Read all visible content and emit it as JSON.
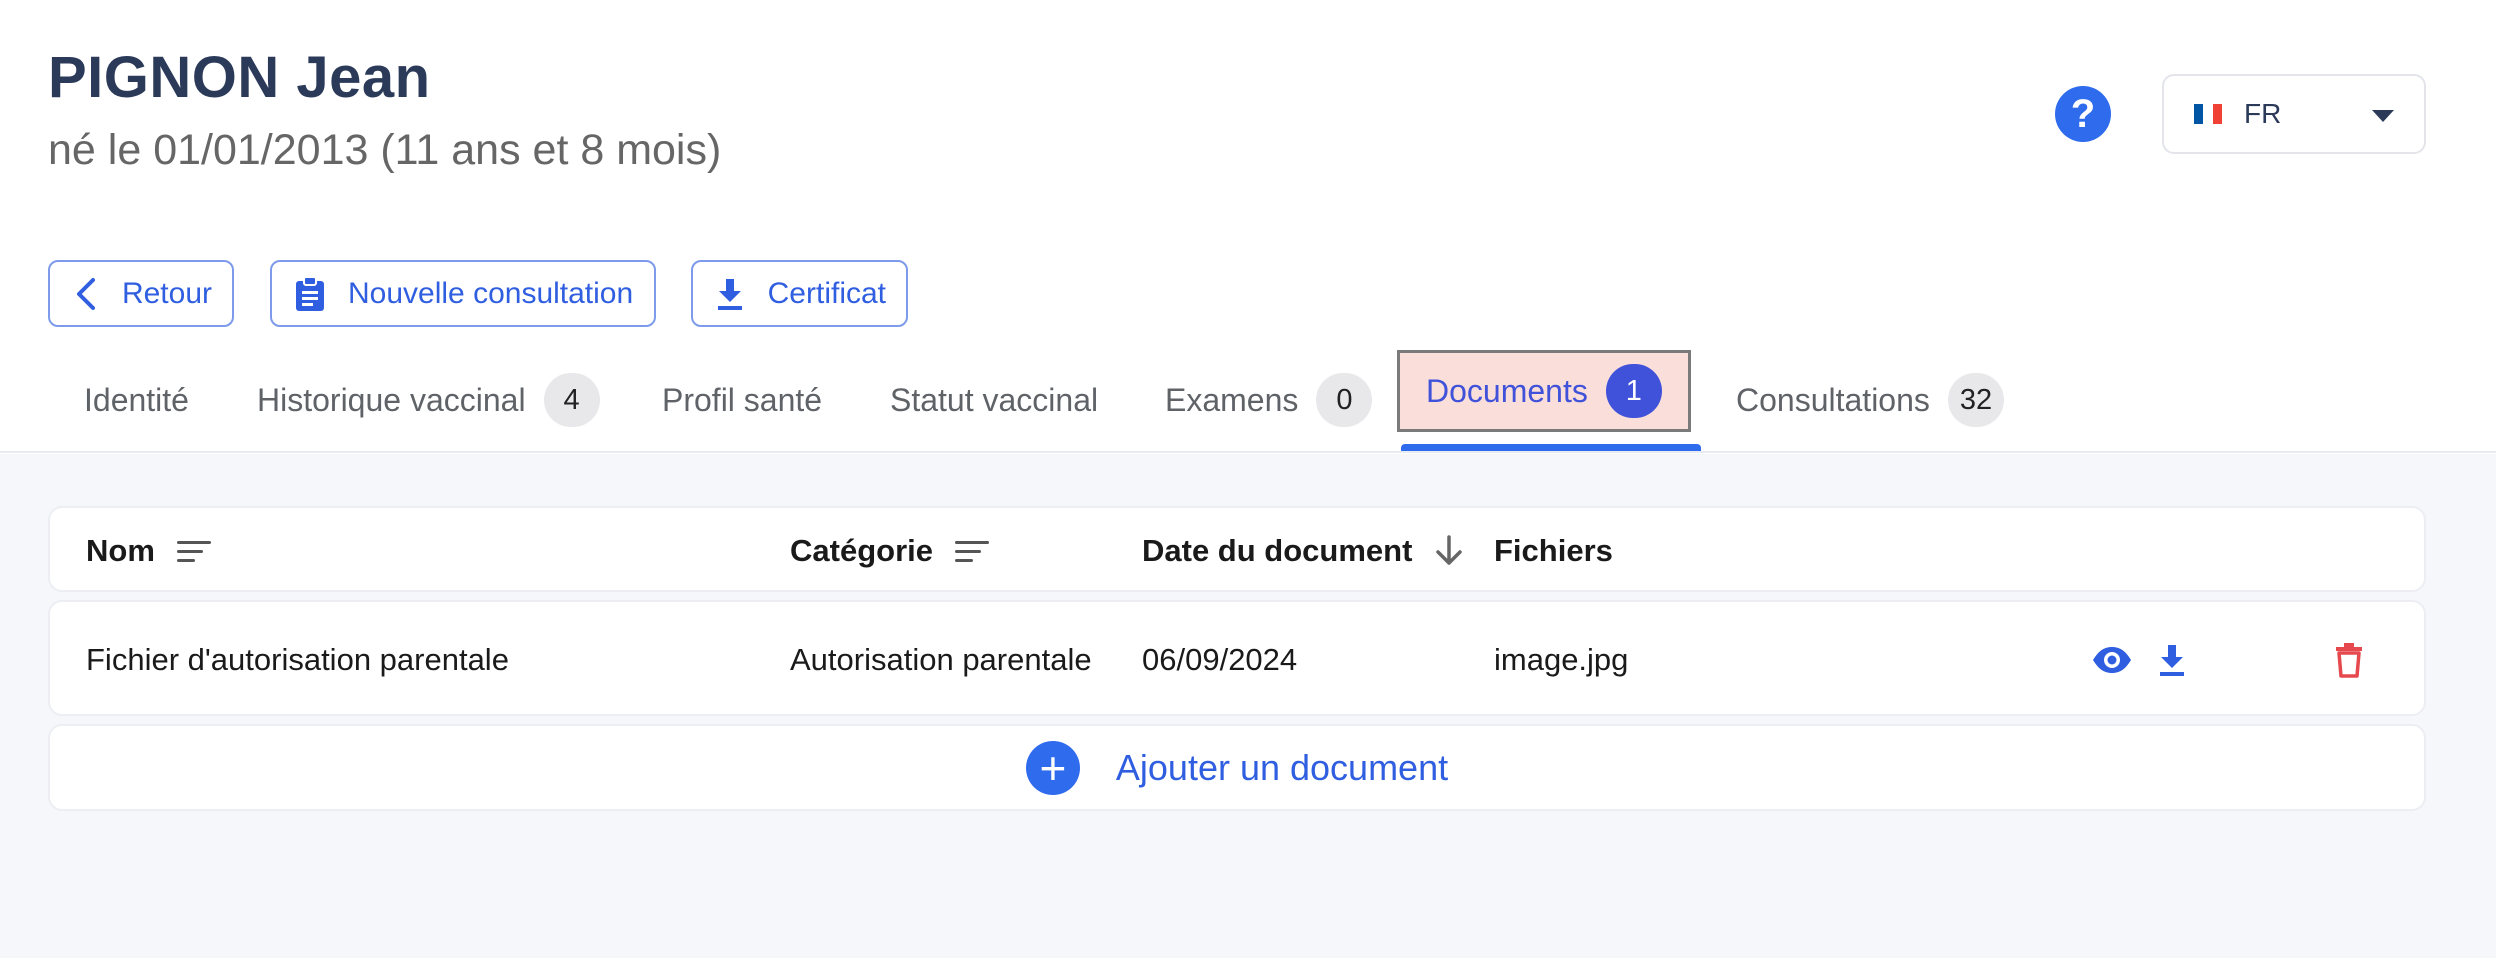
{
  "patient": {
    "name": "PIGNON Jean",
    "birth": "né le 01/01/2013 (11 ans et 8 mois)"
  },
  "header": {
    "help_icon": "question-circle-icon",
    "help_glyph": "?",
    "language": "FR",
    "flag_colors": [
      "#0055a4",
      "#ffffff",
      "#ef4135"
    ]
  },
  "actions": {
    "back": "Retour",
    "new_consultation": "Nouvelle consultation",
    "certificate": "Certificat"
  },
  "tabs": [
    {
      "label": "Identité",
      "count": null
    },
    {
      "label": "Historique vaccinal",
      "count": "4"
    },
    {
      "label": "Profil santé",
      "count": null
    },
    {
      "label": "Statut vaccinal",
      "count": null
    },
    {
      "label": "Examens",
      "count": "0"
    },
    {
      "label": "Documents",
      "count": "1",
      "active": true
    },
    {
      "label": "Consultations",
      "count": "32"
    }
  ],
  "table": {
    "columns": {
      "name": "Nom",
      "category": "Catégorie",
      "date": "Date du document",
      "files": "Fichiers"
    },
    "rows": [
      {
        "name": "Fichier d'autorisation parentale",
        "category": "Autorisation parentale",
        "date": "06/09/2024",
        "file": "image.jpg"
      }
    ],
    "add_label": "Ajouter un document",
    "add_glyph": "+"
  },
  "colors": {
    "primary": "#2f6bed",
    "danger": "#e5484d",
    "active_tab_bg": "#f9ded9"
  }
}
